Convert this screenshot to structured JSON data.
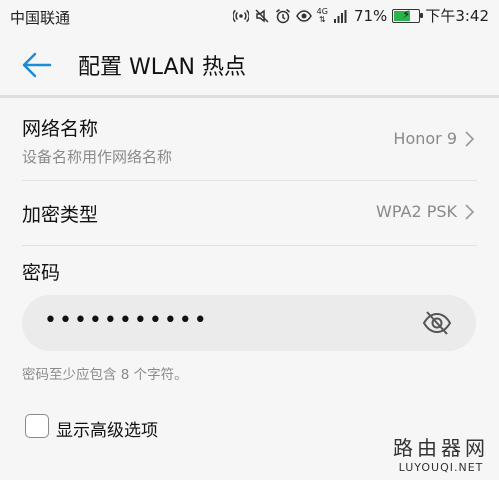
{
  "status_bar": {
    "carrier": "中国联通",
    "network": "4G",
    "battery_percent": "71%",
    "battery_level": 0.71,
    "time": "下午3:42",
    "icons": [
      "hotspot-icon",
      "mute-icon",
      "alarm-icon",
      "eye-comfort-icon",
      "signal-icon",
      "battery-icon"
    ]
  },
  "header": {
    "title": "配置 WLAN 热点"
  },
  "network_name": {
    "label": "网络名称",
    "sublabel": "设备名称用作网络名称",
    "value": "Honor 9"
  },
  "encryption": {
    "label": "加密类型",
    "value": "WPA2 PSK"
  },
  "password": {
    "label": "密码",
    "masked_value": "•••••••••••",
    "hint": "密码至少应包含 8 个字符。"
  },
  "show_advanced": {
    "label": "显示高级选项",
    "checked": false
  },
  "watermark": {
    "cn": "路由器网",
    "en": "LUYOUQI.NET"
  },
  "colors": {
    "accent": "#1a8cd8",
    "battery": "#2bb24c",
    "secondary_text": "#8a8a8a"
  }
}
